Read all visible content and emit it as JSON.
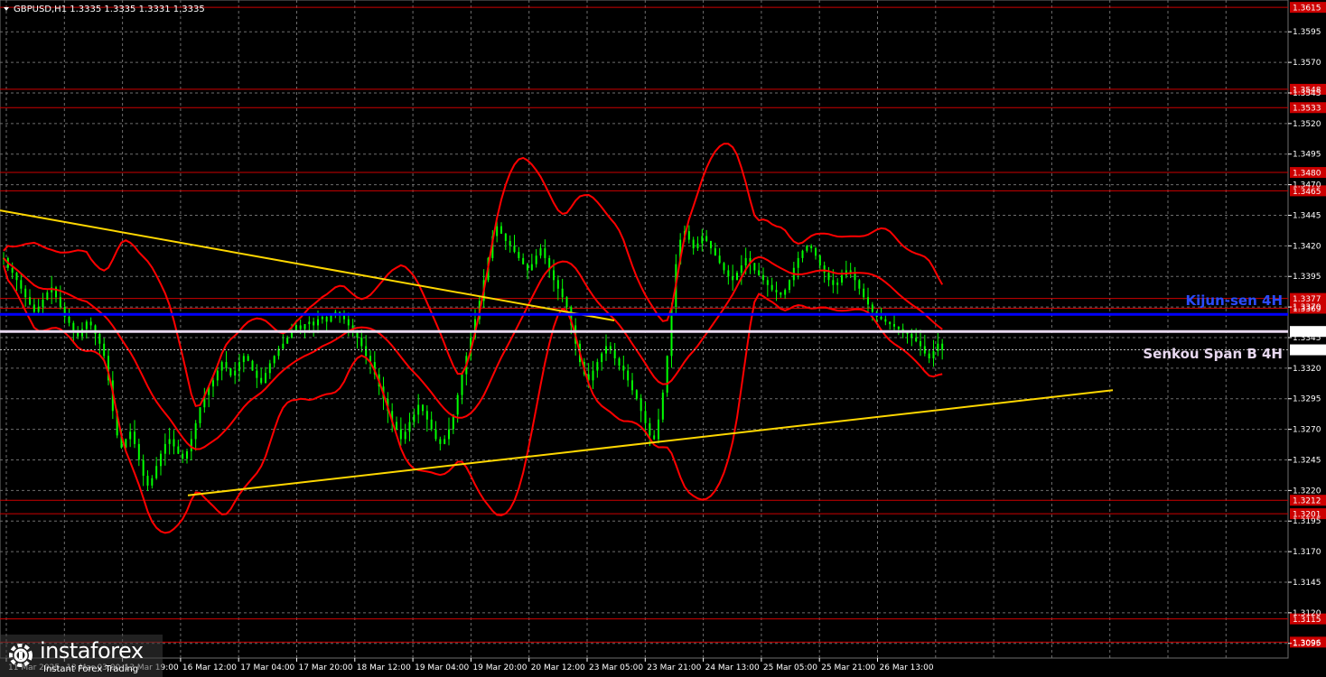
{
  "header": {
    "symbol_info": "GBPUSD,H1  1.3335 1.3335 1.3331 1.3335",
    "menu_icon": "triangle-down-icon"
  },
  "watermark": {
    "brand": "instaforex",
    "tagline": "Instant Forex Trading",
    "brand_icon": "gear-icon"
  },
  "colors": {
    "background": "#000000",
    "grid": "#6e6e6e",
    "candle_up": "#00ff00",
    "candle_down": "#00ff00",
    "bollinger": "#ff0000",
    "trendline": "#ffd700",
    "level_line": "#cc0000",
    "level_label_bg": "#cc0000",
    "kijun": "#0000ff",
    "kijun_label": "#2a4cff",
    "senkou": "#e8d8f0",
    "price_label_bg": "#ffffff",
    "axis_text": "#ffffff"
  },
  "chart_data": {
    "type": "candlestick",
    "title": "GBPUSD,H1",
    "ylim": [
      1.3083,
      1.3621
    ],
    "y_ticks": [
      "1.3595",
      "1.3570",
      "1.3545",
      "1.3520",
      "1.3495",
      "1.3470",
      "1.3445",
      "1.3420",
      "1.3395",
      "1.3370",
      "1.3345",
      "1.3320",
      "1.3295",
      "1.3270",
      "1.3245",
      "1.3220",
      "1.3195",
      "1.3170",
      "1.3145",
      "1.3120",
      "1.3095"
    ],
    "x_ticks": [
      "11 Mar 2025",
      "13 Mar 03:00",
      "13 Mar 19:00",
      "16 Mar 12:00",
      "17 Mar 04:00",
      "17 Mar 20:00",
      "18 Mar 12:00",
      "19 Mar 04:00",
      "19 Mar 20:00",
      "20 Mar 12:00",
      "23 Mar 05:00",
      "23 Mar 21:00",
      "24 Mar 13:00",
      "25 Mar 05:00",
      "25 Mar 21:00",
      "26 Mar 13:00"
    ],
    "levels": [
      {
        "value": 1.3615,
        "label": "1.3615"
      },
      {
        "value": 1.3548,
        "label": "1.3548"
      },
      {
        "value": 1.3533,
        "label": "1.3533"
      },
      {
        "value": 1.348,
        "label": "1.3480"
      },
      {
        "value": 1.3465,
        "label": "1.3465"
      },
      {
        "value": 1.3377,
        "label": "1.3377"
      },
      {
        "value": 1.3369,
        "label": "1.3369"
      },
      {
        "value": 1.3212,
        "label": "1.3212"
      },
      {
        "value": 1.3201,
        "label": "1.3201"
      },
      {
        "value": 1.3115,
        "label": "1.3115"
      },
      {
        "value": 1.3096,
        "label": "1.3096"
      }
    ],
    "kijun_sen": {
      "value": 1.3364,
      "label": "Kijun-sen 4H"
    },
    "senkou_span_b": {
      "value": 1.335,
      "label": "Senkou Span B 4H",
      "price_label": "1.3350"
    },
    "current_price": {
      "value": 1.3335,
      "label": "1.3335"
    },
    "trendlines": [
      {
        "x1": 0,
        "y1": 1.3449,
        "x2": 680,
        "y2": 1.3359
      },
      {
        "x1": 208,
        "y1": 1.3216,
        "x2": 1232,
        "y2": 1.3302
      }
    ],
    "close_series": [
      1.341,
      1.3402,
      1.3398,
      1.3392,
      1.3385,
      1.3378,
      1.3372,
      1.3366,
      1.337,
      1.3376,
      1.3382,
      1.3386,
      1.3378,
      1.337,
      1.3362,
      1.3357,
      1.335,
      1.3346,
      1.3352,
      1.3358,
      1.3355,
      1.3348,
      1.334,
      1.333,
      1.331,
      1.3285,
      1.3265,
      1.3255,
      1.3262,
      1.3268,
      1.3258,
      1.3245,
      1.3232,
      1.3224,
      1.323,
      1.324,
      1.325,
      1.3258,
      1.3262,
      1.3256,
      1.325,
      1.3246,
      1.3252,
      1.3262,
      1.3275,
      1.3288,
      1.3298,
      1.3305,
      1.331,
      1.3318,
      1.3325,
      1.332,
      1.3314,
      1.3318,
      1.3325,
      1.333,
      1.3326,
      1.3318,
      1.3312,
      1.3308,
      1.3316,
      1.3324,
      1.333,
      1.3336,
      1.334,
      1.3345,
      1.335,
      1.3355,
      1.3352,
      1.3356,
      1.3358,
      1.3355,
      1.336,
      1.3362,
      1.3358,
      1.3364,
      1.3366,
      1.3363,
      1.336,
      1.3355,
      1.335,
      1.3345,
      1.3338,
      1.333,
      1.3325,
      1.3315,
      1.3305,
      1.3295,
      1.3285,
      1.3276,
      1.327,
      1.3262,
      1.3268,
      1.3276,
      1.3282,
      1.329,
      1.3285,
      1.3278,
      1.327,
      1.3262,
      1.3258,
      1.3262,
      1.327,
      1.3282,
      1.3298,
      1.3315,
      1.333,
      1.3345,
      1.336,
      1.3375,
      1.3392,
      1.341,
      1.3428,
      1.3436,
      1.343,
      1.3424,
      1.342,
      1.3415,
      1.341,
      1.3405,
      1.34,
      1.3405,
      1.3412,
      1.3418,
      1.341,
      1.34,
      1.3392,
      1.3385,
      1.3378,
      1.337,
      1.3355,
      1.334,
      1.3325,
      1.3315,
      1.331,
      1.3318,
      1.3325,
      1.3332,
      1.3338,
      1.3335,
      1.3328,
      1.3322,
      1.3318,
      1.331,
      1.3302,
      1.3295,
      1.3285,
      1.3275,
      1.3265,
      1.3262,
      1.3278,
      1.33,
      1.333,
      1.337,
      1.3405,
      1.3425,
      1.3432,
      1.3425,
      1.3418,
      1.3422,
      1.3428,
      1.3424,
      1.3418,
      1.3412,
      1.3406,
      1.34,
      1.3395,
      1.3392,
      1.3398,
      1.3404,
      1.341,
      1.3406,
      1.34,
      1.3396,
      1.3392,
      1.3388,
      1.3384,
      1.3382,
      1.338,
      1.3384,
      1.3392,
      1.3402,
      1.341,
      1.3416,
      1.342,
      1.3418,
      1.3412,
      1.3404,
      1.3398,
      1.3392,
      1.3388,
      1.339,
      1.3396,
      1.34,
      1.3398,
      1.3392,
      1.3385,
      1.3378,
      1.3372,
      1.3366,
      1.3362,
      1.336,
      1.3358,
      1.3356,
      1.3354,
      1.3352,
      1.335,
      1.3348,
      1.3345,
      1.3342,
      1.3338,
      1.3332,
      1.3328,
      1.3334,
      1.334,
      1.3335
    ]
  }
}
